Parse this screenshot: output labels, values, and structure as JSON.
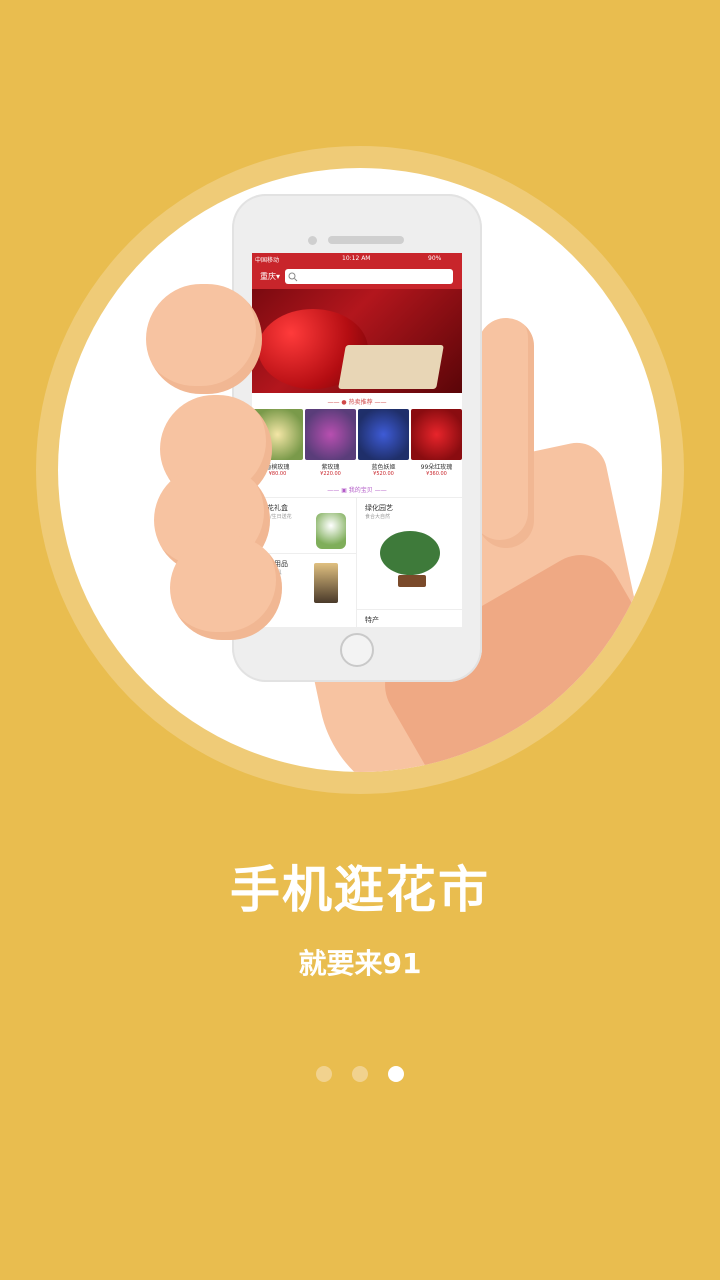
{
  "onboarding": {
    "title": "手机逛花市",
    "subtitle": "就要来91",
    "page_index": 3,
    "page_count": 3
  },
  "colors": {
    "background": "#E9BD4F",
    "ring": "#EFCB77",
    "app_red": "#C8252B",
    "dot_inactive": "#F1D28E",
    "dot_active": "#FFFFFF"
  },
  "phone_screen": {
    "status": {
      "carrier": "中国移动",
      "time": "10:12 AM",
      "battery": "90%"
    },
    "city": "重庆",
    "hot_section": "热卖推荐",
    "hot_products": [
      {
        "name": "香槟玫瑰",
        "price": "¥80.00"
      },
      {
        "name": "紫玫瑰",
        "price": "¥220.00"
      },
      {
        "name": "蓝色妖姬",
        "price": "¥520.00"
      },
      {
        "name": "99朵红玫瑰",
        "price": "¥360.00"
      }
    ],
    "baby_section": "我的宝贝",
    "categories": [
      {
        "name": "鲜花礼盒",
        "desc": "节日/生日送花"
      },
      {
        "name": "绿化园艺",
        "desc": "食合大自然"
      },
      {
        "name": "宠物用品",
        "desc": "口粮/玩具"
      },
      {
        "name": "特产",
        "desc": ""
      }
    ]
  }
}
